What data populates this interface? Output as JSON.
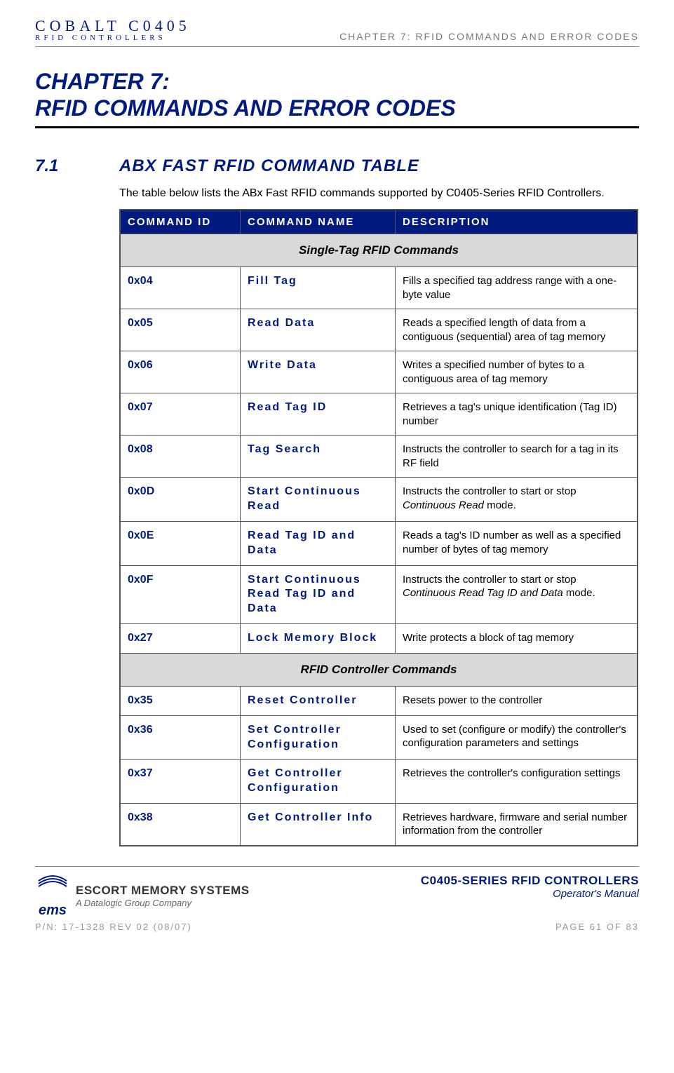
{
  "header": {
    "logo_top": "COBALT C0405",
    "logo_bottom": "RFID CONTROLLERS",
    "chapter_ref": "CHAPTER 7: RFID COMMANDS AND ERROR CODES"
  },
  "chapter": {
    "line1": "CHAPTER 7:",
    "line2": "RFID COMMANDS AND ERROR CODES"
  },
  "section": {
    "number": "7.1",
    "title_parts": [
      "AB",
      "X",
      " F",
      "AST",
      " RFID C",
      "OMMAND",
      " T",
      "ABLE"
    ],
    "title_plain": "ABX FAST RFID COMMAND TABLE",
    "intro": "The table below lists the ABx Fast RFID commands supported by C0405-Series RFID Controllers."
  },
  "table": {
    "headers": {
      "id": "COMMAND ID",
      "name": "COMMAND NAME",
      "desc": "DESCRIPTION"
    },
    "group1_title": "Single-Tag RFID Commands",
    "group2_title": "RFID Controller Commands",
    "rows_group1": [
      {
        "id": "0x04",
        "name": "Fill Tag",
        "desc": "Fills a specified tag address range with a one-byte value"
      },
      {
        "id": "0x05",
        "name": "Read Data",
        "desc": "Reads a specified length of data from a contiguous (sequential) area of tag memory"
      },
      {
        "id": "0x06",
        "name": "Write Data",
        "desc": "Writes a specified number of bytes to a contiguous area of tag memory"
      },
      {
        "id": "0x07",
        "name": "Read Tag ID",
        "desc": "Retrieves a tag's unique identification (Tag ID) number"
      },
      {
        "id": "0x08",
        "name": "Tag Search",
        "desc": "Instructs the controller to search for a tag in its RF field"
      },
      {
        "id": "0x0D",
        "name": "Start Continuous Read",
        "desc_pre": "Instructs the controller to start or stop ",
        "desc_italic": "Continuous Read",
        "desc_post": " mode."
      },
      {
        "id": "0x0E",
        "name": "Read Tag ID and Data",
        "desc": "Reads a tag's ID number as well as a specified number of bytes of tag memory"
      },
      {
        "id": "0x0F",
        "name": "Start Continuous Read Tag ID and Data",
        "desc_pre": "Instructs the controller to start or stop ",
        "desc_italic": "Continuous Read Tag ID and Data",
        "desc_post": " mode."
      },
      {
        "id": "0x27",
        "name": "Lock Memory Block",
        "desc": "Write protects a block of tag memory"
      }
    ],
    "rows_group2": [
      {
        "id": "0x35",
        "name": "Reset Controller",
        "desc": "Resets power to the controller"
      },
      {
        "id": "0x36",
        "name": "Set Controller Configuration",
        "desc": "Used to set (configure or modify) the controller's configuration parameters and settings"
      },
      {
        "id": "0x37",
        "name": "Get Controller Configuration",
        "desc": "Retrieves the controller's configuration settings"
      },
      {
        "id": "0x38",
        "name": "Get Controller Info",
        "desc": "Retrieves hardware, firmware and serial number information from the controller"
      }
    ]
  },
  "footer": {
    "escort_top": "ESCORT MEMORY SYSTEMS",
    "escort_bottom": "A Datalogic Group Company",
    "ems_text": "ems",
    "ctrl_title": "C0405-SERIES RFID CONTROLLERS",
    "ctrl_sub": "Operator's Manual",
    "pn": "P/N: 17-1328 REV 02 (08/07)",
    "page": "PAGE 61 OF 83"
  }
}
